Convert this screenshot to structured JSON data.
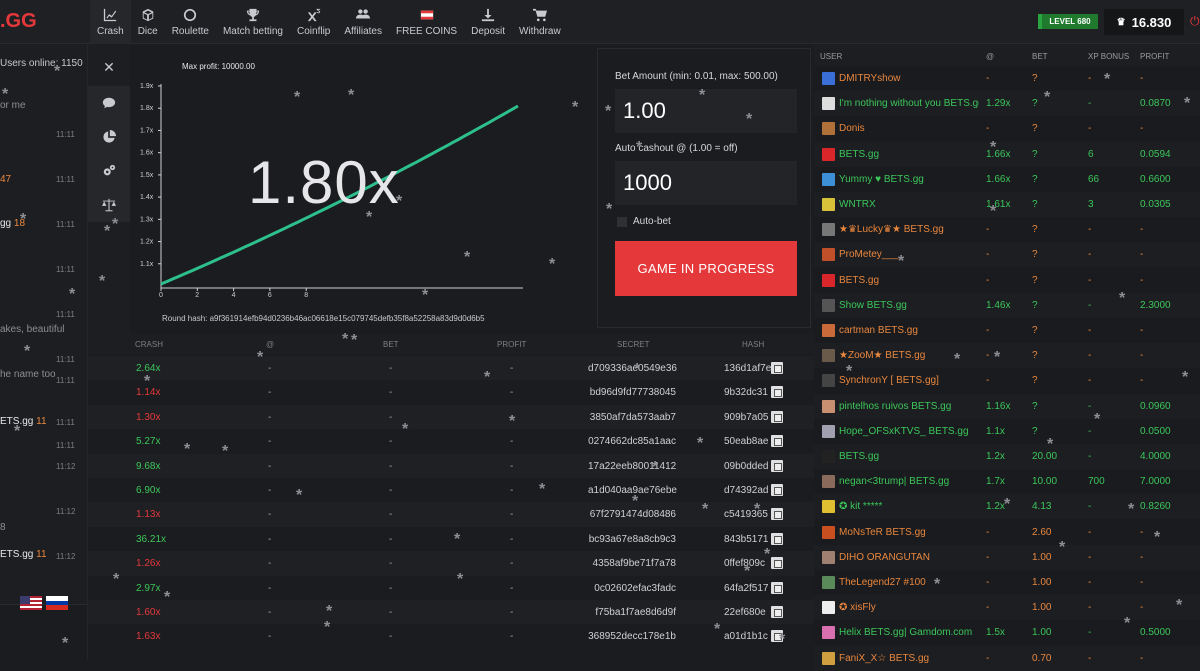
{
  "brand": {
    "logo_text": ".GG"
  },
  "nav": [
    {
      "label": "Crash",
      "icon": "chart-line-icon"
    },
    {
      "label": "Dice",
      "icon": "cube-icon"
    },
    {
      "label": "Roulette",
      "icon": "circle-icon"
    },
    {
      "label": "Match betting",
      "icon": "trophy-icon"
    },
    {
      "label": "Coinflip",
      "icon": "x-squared-icon"
    },
    {
      "label": "Affiliates",
      "icon": "users-icon"
    },
    {
      "label": "FREE COINS",
      "icon": "flag-icon"
    },
    {
      "label": "Deposit",
      "icon": "download-icon"
    },
    {
      "label": "Withdraw",
      "icon": "cart-icon"
    }
  ],
  "account": {
    "level": "LEVEL 680",
    "balance": "16.830"
  },
  "chat": {
    "online": "Users online: 1150",
    "fragments": [
      {
        "text": "or me",
        "cls": ""
      },
      {
        "text": "47",
        "cls": "chat-hl"
      },
      {
        "text": "akes, beautiful",
        "cls": ""
      },
      {
        "text": "he name too",
        "cls": ""
      },
      {
        "text": "8",
        "cls": ""
      }
    ],
    "user_fragments": [
      {
        "name": "gg",
        "num": "18"
      },
      {
        "name": "ETS.gg",
        "num": "11"
      },
      {
        "name": "ETS.gg",
        "num": "11"
      }
    ],
    "times": [
      "11:11",
      "11:11",
      "11:11",
      "11:11",
      "11:11",
      "11:11",
      "11:11",
      "11:11",
      "11:11",
      "11:12",
      "11:12",
      "11:12"
    ]
  },
  "graph": {
    "max_profit": "Max profit: 10000.00",
    "multiplier": "1.80x",
    "round_hash": "Round hash: a9f361914efb94d0236b46ac06618e15c079745defb35f8a52258a83d9d0d6b5",
    "y_ticks": [
      "1.9x",
      "1.8x",
      "1.7x",
      "1.6x",
      "1.5x",
      "1.4x",
      "1.3x",
      "1.2x",
      "1.1x"
    ],
    "x_ticks": [
      "0",
      "2",
      "4",
      "6",
      "8"
    ]
  },
  "bet": {
    "amount_label": "Bet Amount (min: 0.01, max: 500.00)",
    "amount_value": "1.00",
    "cashout_label": "Auto cashout @ (1.00 = off)",
    "cashout_value": "1000",
    "autobet_label": "Auto-bet",
    "button_label": "GAME IN PROGRESS"
  },
  "history": {
    "headers": {
      "crash": "CRASH",
      "at": "@",
      "bet": "BET",
      "profit": "PROFIT",
      "secret": "SECRET",
      "hash": "HASH"
    },
    "rows": [
      {
        "crash": "2.64x",
        "status": "green",
        "at": "-",
        "bet": "-",
        "profit": "-",
        "secret": "d709336ae0549e36",
        "hash": "136d1af7e"
      },
      {
        "crash": "1.14x",
        "status": "red",
        "at": "-",
        "bet": "-",
        "profit": "-",
        "secret": "bd96d9fd77738045",
        "hash": "9b32dc31"
      },
      {
        "crash": "1.30x",
        "status": "red",
        "at": "-",
        "bet": "-",
        "profit": "-",
        "secret": "3850af7da573aab7",
        "hash": "909b7a05"
      },
      {
        "crash": "5.27x",
        "status": "green",
        "at": "-",
        "bet": "-",
        "profit": "-",
        "secret": "0274662dc85a1aac",
        "hash": "50eab8ae"
      },
      {
        "crash": "9.68x",
        "status": "green",
        "at": "-",
        "bet": "-",
        "profit": "-",
        "secret": "17a22eeb80011412",
        "hash": "09b0dded"
      },
      {
        "crash": "6.90x",
        "status": "green",
        "at": "-",
        "bet": "-",
        "profit": "-",
        "secret": "a1d040aa9ae76ebe",
        "hash": "d74392ad"
      },
      {
        "crash": "1.13x",
        "status": "red",
        "at": "-",
        "bet": "-",
        "profit": "-",
        "secret": "67f2791474d08486",
        "hash": "c5419365"
      },
      {
        "crash": "36.21x",
        "status": "green",
        "at": "-",
        "bet": "-",
        "profit": "-",
        "secret": "bc93a67e8a8cb9c3",
        "hash": "843b5171"
      },
      {
        "crash": "1.26x",
        "status": "red",
        "at": "-",
        "bet": "-",
        "profit": "-",
        "secret": "4358af9be71f7a78",
        "hash": "0ffef809c"
      },
      {
        "crash": "2.97x",
        "status": "green",
        "at": "-",
        "bet": "-",
        "profit": "-",
        "secret": "0c02602efac3fadc",
        "hash": "64fa2f517"
      },
      {
        "crash": "1.60x",
        "status": "red",
        "at": "-",
        "bet": "-",
        "profit": "-",
        "secret": "f75ba1f7ae8d6d9f",
        "hash": "22ef680e"
      },
      {
        "crash": "1.63x",
        "status": "red",
        "at": "-",
        "bet": "-",
        "profit": "-",
        "secret": "368952decc178e1b",
        "hash": "a01d1b1c"
      }
    ]
  },
  "users": {
    "headers": {
      "user": "USER",
      "at": "@",
      "bet": "BET",
      "xp": "XP BONUS",
      "profit": "PROFIT"
    },
    "rows": [
      {
        "name": "DMITRYshow",
        "color": "orange",
        "avatar": "#3a6fd8",
        "at": "-",
        "bet": "?",
        "xp": "-",
        "profit": "-",
        "pc": "orange"
      },
      {
        "name": "I'm nothing without you BETS.gg",
        "color": "green",
        "avatar": "#dddddd",
        "at": "1.29x",
        "bet": "?",
        "xp": "-",
        "profit": "0.0870",
        "pc": "green"
      },
      {
        "name": "Donis",
        "color": "orange",
        "avatar": "#b0703a",
        "at": "-",
        "bet": "?",
        "xp": "-",
        "profit": "-",
        "pc": "orange"
      },
      {
        "name": "BETS.gg",
        "color": "green",
        "avatar": "#d8262b",
        "at": "1.66x",
        "bet": "?",
        "xp": "6",
        "profit": "0.0594",
        "pc": "green"
      },
      {
        "name": "Yummy ♥ BETS.gg",
        "color": "green",
        "avatar": "#3d8fd6",
        "at": "1.66x",
        "bet": "?",
        "xp": "66",
        "profit": "0.6600",
        "pc": "green"
      },
      {
        "name": "WNTRX",
        "color": "green",
        "avatar": "#d8c23a",
        "at": "1.61x",
        "bet": "?",
        "xp": "3",
        "profit": "0.0305",
        "pc": "green"
      },
      {
        "name": "★♛Lucky♛★ BETS.gg",
        "color": "orange",
        "avatar": "#777777",
        "at": "-",
        "bet": "?",
        "xp": "-",
        "profit": "-",
        "pc": "orange"
      },
      {
        "name": "ProMetey___",
        "color": "orange",
        "avatar": "#c0502a",
        "at": "-",
        "bet": "?",
        "xp": "-",
        "profit": "-",
        "pc": "orange"
      },
      {
        "name": "BETS.gg",
        "color": "orange",
        "avatar": "#d8262b",
        "at": "-",
        "bet": "?",
        "xp": "-",
        "profit": "-",
        "pc": "orange"
      },
      {
        "name": "Show BETS.gg",
        "color": "green",
        "avatar": "#555555",
        "at": "1.46x",
        "bet": "?",
        "xp": "-",
        "profit": "2.3000",
        "pc": "green"
      },
      {
        "name": "cartman BETS.gg",
        "color": "orange",
        "avatar": "#c86a3a",
        "at": "-",
        "bet": "?",
        "xp": "-",
        "profit": "-",
        "pc": "orange"
      },
      {
        "name": "★ZooM★ BETS.gg",
        "color": "orange",
        "avatar": "#6a5a4a",
        "at": "-",
        "bet": "?",
        "xp": "-",
        "profit": "-",
        "pc": "orange"
      },
      {
        "name": "SynchronY [ BETS.gg]",
        "color": "orange",
        "avatar": "#444444",
        "at": "-",
        "bet": "?",
        "xp": "-",
        "profit": "-",
        "pc": "orange"
      },
      {
        "name": "pintelhos ruivos BETS.gg",
        "color": "green",
        "avatar": "#c89070",
        "at": "1.16x",
        "bet": "?",
        "xp": "-",
        "profit": "0.0960",
        "pc": "green"
      },
      {
        "name": "Hope_OFSxKTVS_ BETS.gg",
        "color": "green",
        "avatar": "#a0a0b0",
        "at": "1.1x",
        "bet": "?",
        "xp": "-",
        "profit": "0.0500",
        "pc": "green"
      },
      {
        "name": "BETS.gg",
        "color": "green",
        "avatar": "#222222",
        "at": "1.2x",
        "bet": "20.00",
        "xp": "-",
        "profit": "4.0000",
        "pc": "green"
      },
      {
        "name": "negan<3trump| BETS.gg",
        "color": "green",
        "avatar": "#8a6a5a",
        "at": "1.7x",
        "bet": "10.00",
        "xp": "700",
        "profit": "7.0000",
        "pc": "green"
      },
      {
        "name": "✪ kit *****",
        "color": "green",
        "avatar": "#e0c030",
        "at": "1.2x",
        "bet": "4.13",
        "xp": "-",
        "profit": "0.8260",
        "pc": "green"
      },
      {
        "name": "MoNsTeR BETS.gg",
        "color": "orange",
        "avatar": "#c85020",
        "at": "-",
        "bet": "2.60",
        "xp": "-",
        "profit": "-",
        "pc": "orange"
      },
      {
        "name": "DIHO ORANGUTAN",
        "color": "orange",
        "avatar": "#a08070",
        "at": "-",
        "bet": "1.00",
        "xp": "-",
        "profit": "-",
        "pc": "orange"
      },
      {
        "name": "TheLegend27 #100",
        "color": "orange",
        "avatar": "#5a8a5a",
        "at": "-",
        "bet": "1.00",
        "xp": "-",
        "profit": "-",
        "pc": "orange"
      },
      {
        "name": "✪ xisFly",
        "color": "orange",
        "avatar": "#eeeeee",
        "at": "-",
        "bet": "1.00",
        "xp": "-",
        "profit": "-",
        "pc": "orange"
      },
      {
        "name": "Helix BETS.gg| Gamdom.com",
        "color": "green",
        "avatar": "#d870b0",
        "at": "1.5x",
        "bet": "1.00",
        "xp": "-",
        "profit": "0.5000",
        "pc": "green"
      },
      {
        "name": "FaniX_X☆ BETS.gg",
        "color": "orange",
        "avatar": "#d0a040",
        "at": "-",
        "bet": "0.70",
        "xp": "-",
        "profit": "-",
        "pc": "orange"
      }
    ]
  },
  "colors": {
    "accent_red": "#e5383b",
    "green": "#3bc75a",
    "orange": "#e9873e",
    "curve": "#2dbf8c"
  }
}
